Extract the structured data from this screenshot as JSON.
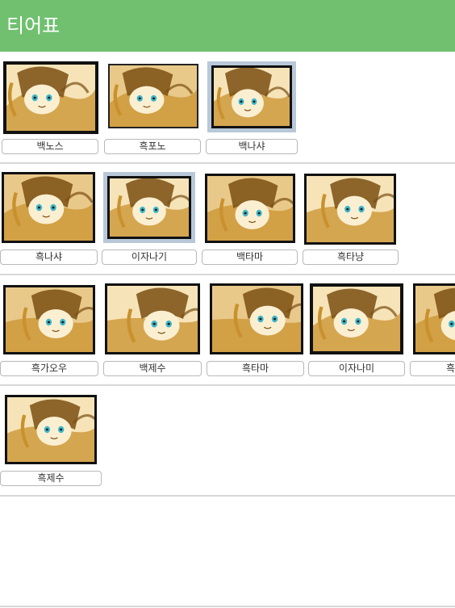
{
  "header": {
    "title": "티어표"
  },
  "rows": [
    {
      "cards": [
        {
          "label": "백노스",
          "selected": false,
          "tone": "light"
        },
        {
          "label": "흑포노",
          "selected": false,
          "tone": "dark"
        },
        {
          "label": "백나샤",
          "selected": true,
          "tone": "light"
        }
      ]
    },
    {
      "cards": [
        {
          "label": "흑나샤",
          "selected": false,
          "tone": "dark"
        },
        {
          "label": "이자나기",
          "selected": true,
          "tone": "light"
        },
        {
          "label": "백타마",
          "selected": false,
          "tone": "light"
        },
        {
          "label": "흑타냥",
          "selected": false,
          "tone": "dark"
        }
      ]
    },
    {
      "cards": [
        {
          "label": "흑가오우",
          "selected": false,
          "tone": "dark"
        },
        {
          "label": "백제수",
          "selected": false,
          "tone": "light"
        },
        {
          "label": "흑타마",
          "selected": false,
          "tone": "light"
        },
        {
          "label": "이자나미",
          "selected": false,
          "tone": "light"
        },
        {
          "label": "흑",
          "selected": false,
          "tone": "dark"
        }
      ]
    },
    {
      "cards": [
        {
          "label": "흑제수",
          "selected": false,
          "tone": "dark"
        }
      ]
    }
  ],
  "colors": {
    "header": "#70c070",
    "selected_border": "#b8c8d8",
    "frame": "#111111",
    "sepia_light": "#f6e4b8",
    "sepia_mid": "#c9912e",
    "sepia_dark": "#7a4f12",
    "accent": "#3fb7c9"
  }
}
